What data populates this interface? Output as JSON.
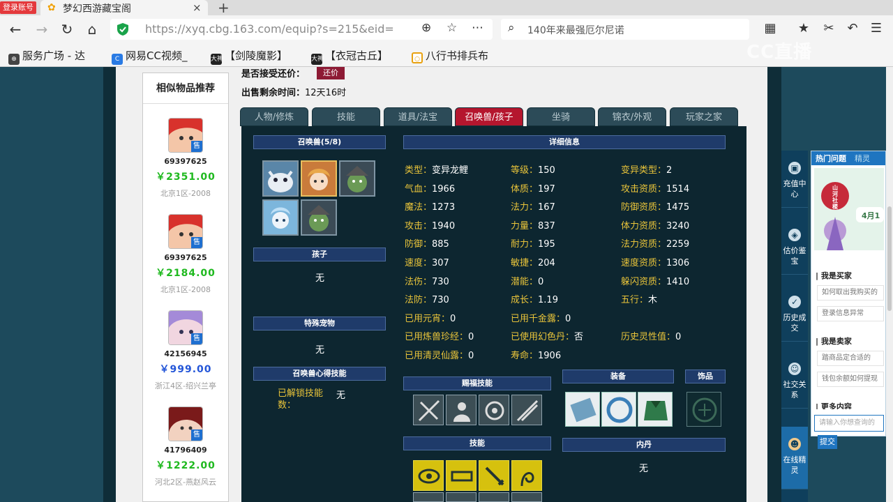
{
  "browser": {
    "login_badge": "登录账号",
    "tab_title": "梦幻西游藏宝阁",
    "url": "https://xyq.cbg.163.com/equip?s=215&eid=",
    "search_text": "140年来最强厄尔尼诺",
    "bookmarks": [
      "服务广场 - 达",
      "网易CC视频_",
      "【剑陵魔影】",
      "【衣冠古丘】",
      "八行书排兵布"
    ],
    "bookmark_badges": [
      "大神",
      "大神"
    ],
    "watermark": "CC直播"
  },
  "similar": {
    "title": "相似物品推荐",
    "sale_badge": "售",
    "items": [
      {
        "id": "69397625",
        "price": "￥2351.00",
        "server": "北京1区-2008",
        "price_color": "#1fb91f"
      },
      {
        "id": "69397625",
        "price": "￥2184.00",
        "server": "北京1区-2008",
        "price_color": "#1fb91f"
      },
      {
        "id": "42156945",
        "price": "￥999.00",
        "server": "浙江4区-绍兴兰亭",
        "price_color": "#2456d8"
      },
      {
        "id": "41796409",
        "price": "￥1222.00",
        "server": "河北2区-燕赵风云",
        "price_color": "#1fb91f"
      }
    ]
  },
  "sale": {
    "accept_counter_label": "是否接受还价：",
    "counter_button": "还价",
    "remaining_label": "出售剩余时间：",
    "remaining_value": "12天16时"
  },
  "tabs": [
    "人物/修炼",
    "技能",
    "道具/法宝",
    "召唤兽/孩子",
    "坐骑",
    "锦衣/外观",
    "玩家之家"
  ],
  "pet": {
    "pets_title": "召唤兽(5/8)",
    "child_title": "孩子",
    "child_value": "无",
    "special_title": "特殊宠物",
    "special_value": "无",
    "heart_title": "召唤兽心得技能",
    "unlock_label": "已解锁技能数：",
    "unlock_value": "无",
    "detail_title": "详细信息",
    "gift_skills_title": "赐福技能",
    "equip_title": "装备",
    "ornament_title": "饰品",
    "skills_title": "技能",
    "neidan_title": "内丹",
    "neidan_value": "无",
    "details": [
      [
        "类型：",
        "变异龙鲤"
      ],
      [
        "等级：",
        "150"
      ],
      [
        "变异类型：",
        "2"
      ],
      [
        "气血：",
        "1966"
      ],
      [
        "体质：",
        "197"
      ],
      [
        "攻击资质：",
        "1514"
      ],
      [
        "魔法：",
        "1273"
      ],
      [
        "法力：",
        "167"
      ],
      [
        "防御资质：",
        "1475"
      ],
      [
        "攻击：",
        "1940"
      ],
      [
        "力量：",
        "837"
      ],
      [
        "体力资质：",
        "3240"
      ],
      [
        "防御：",
        "885"
      ],
      [
        "耐力：",
        "195"
      ],
      [
        "法力资质：",
        "2259"
      ],
      [
        "速度：",
        "307"
      ],
      [
        "敏捷：",
        "204"
      ],
      [
        "速度资质：",
        "1306"
      ],
      [
        "法伤：",
        "730"
      ],
      [
        "潜能：",
        "0"
      ],
      [
        "躲闪资质：",
        "1410"
      ],
      [
        "法防：",
        "730"
      ],
      [
        "成长：",
        "1.19"
      ],
      [
        "五行：",
        "木"
      ],
      [
        "已用元宵：",
        "0"
      ],
      [
        "已用千金露：",
        "0"
      ],
      [
        "",
        ""
      ],
      [
        "已用炼兽珍经：",
        "0"
      ],
      [
        "已使用幻色丹：",
        "否"
      ],
      [
        "历史灵性值：",
        "0"
      ],
      [
        "已用清灵仙露：",
        "0"
      ],
      [
        "寿命：",
        "1906"
      ],
      [
        "",
        ""
      ]
    ]
  },
  "float_menu": [
    {
      "label": "充值中心",
      "icon": "wallet-icon"
    },
    {
      "label": "估价鉴宝",
      "icon": "appraise-icon"
    },
    {
      "label": "历史成交",
      "icon": "history-icon"
    },
    {
      "label": "社交关系",
      "icon": "social-icon"
    },
    {
      "label": "在线精灵",
      "icon": "sprite-icon"
    }
  ],
  "help": {
    "tab_hot": "热门问题",
    "tab_sprite": "精灵",
    "banner_text": "山河社稷",
    "banner_date": "4月1",
    "buyer_title": "我是买家",
    "buyer_q1": "如何取出我购买的",
    "buyer_q2": "登录信息异常",
    "seller_title": "我是卖家",
    "seller_q1": "踏商品定合适的",
    "seller_q2": "钱包余额如何提现",
    "more_title": "更多内容",
    "input_placeholder": "请输入你想查询的",
    "submit": "提交"
  }
}
